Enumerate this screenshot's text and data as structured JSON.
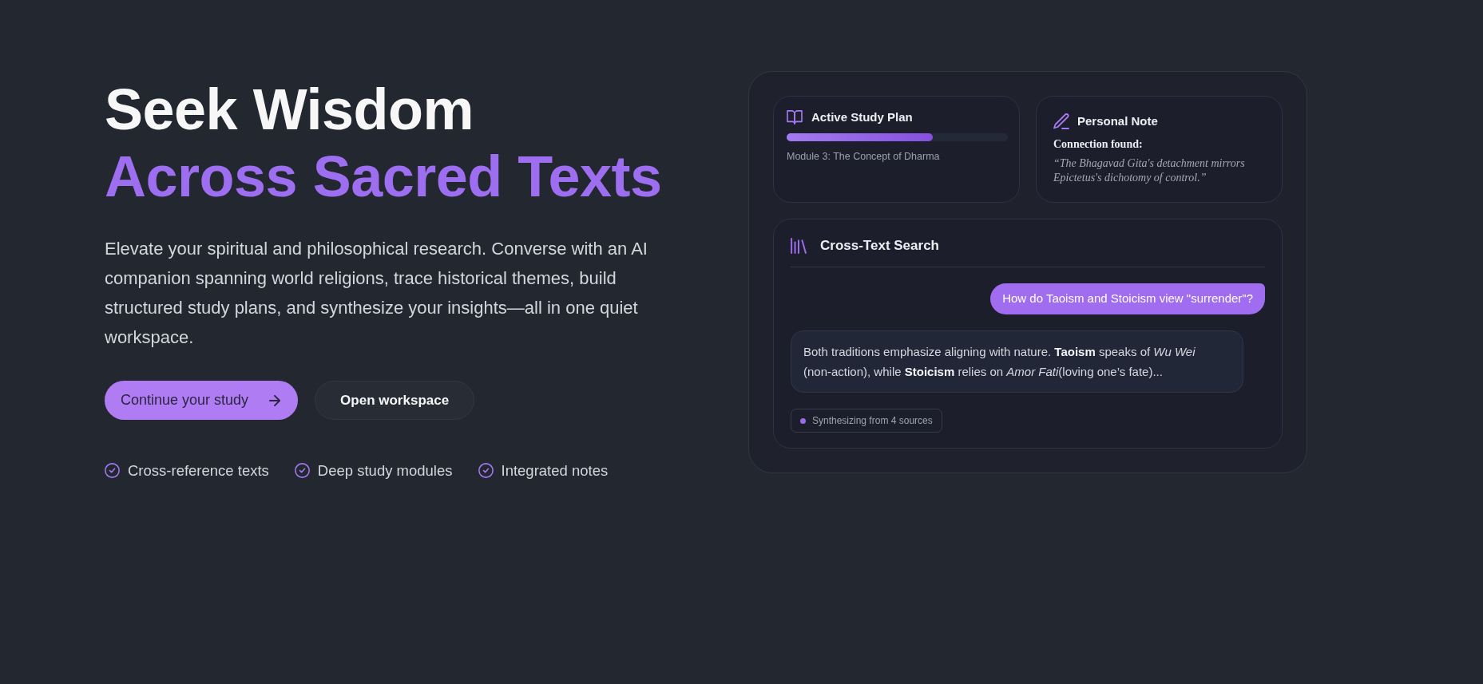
{
  "hero": {
    "title_line_1": "Seek Wisdom",
    "title_line_2": "Across Sacred Texts",
    "description": "Elevate your spiritual and philosophical research. Converse with an AI companion spanning world religions, trace historical themes, build structured study plans, and synthesize your insights—all in one quiet workspace.",
    "buttons": [
      {
        "label": "Continue your study",
        "kind": "primary"
      },
      {
        "label": "Open workspace",
        "kind": "secondary"
      }
    ],
    "features": [
      "Cross-reference texts",
      "Deep study modules",
      "Integrated notes"
    ]
  },
  "preview": {
    "study_plan": {
      "title": "Active Study Plan",
      "level": 0.66,
      "module": "Module 3: The Concept of Dharma"
    },
    "note": {
      "title": "Personal Note",
      "label": "Connection found:",
      "quote": "“The Bhagavad Gita's detachment mirrors Epictetus's dichotomy of control.”"
    },
    "search": {
      "title": "Cross-Text Search",
      "messages": [
        {
          "kind": "user",
          "text": "How do Taoism and Stoicism view \"surrender\"?"
        },
        {
          "kind": "assistant",
          "text": "Both traditions emphasize aligning with nature. **Taoism** speaks of *Wu Wei* (non-action), while **Stoicism** relies on *Amor Fati*(loving one’s fate)..."
        }
      ],
      "status": "Synthesizing from 4 sources"
    }
  }
}
